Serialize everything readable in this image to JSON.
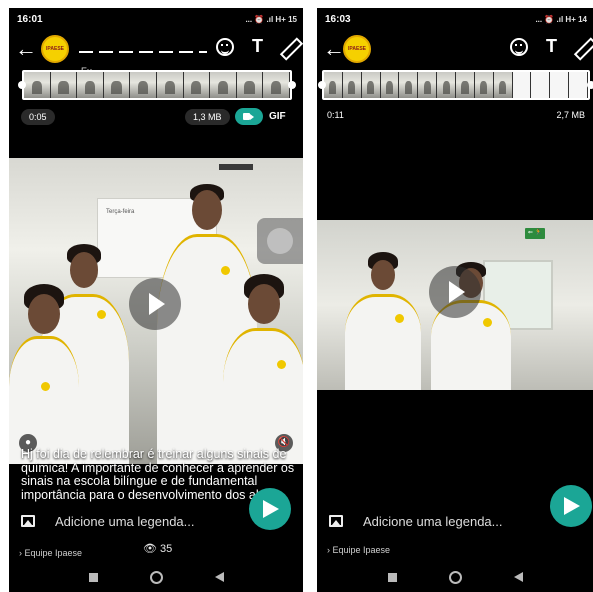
{
  "colors": {
    "accent": "#1ba696",
    "background": "#000000",
    "logo_yellow": "#f5d000"
  },
  "left_screen": {
    "status_time": "16:01",
    "status_icons": "... ⏰ .ıl H+ 15",
    "logo_text": "IPAESE",
    "chat_name": "Eu",
    "duration": "0:05",
    "file_size": "1,3 MB",
    "gif_label": "GIF",
    "caption": "Hj foi dia de relembrar é treinar alguns sinais de química! A importante de conhecer a aprender os sinais na escola bilíngue e de fundamental importância para o desenvolvimento dos al...",
    "caption_placeholder": "Adicione uma legenda...",
    "recipient": "› Equipe Ipaese",
    "views": "35",
    "whiteboard_text": "Terça-feira"
  },
  "right_screen": {
    "status_time": "16:03",
    "status_icons": "... ⏰ .ıl H+ 14",
    "logo_text": "IPAESE",
    "duration": "0:11",
    "file_size": "2,7 MB",
    "exit_sign": "⇐ 🏃",
    "caption_placeholder": "Adicione uma legenda...",
    "recipient": "› Equipe Ipaese"
  },
  "icons": {
    "back": "back-arrow-icon",
    "emoji": "emoji-icon",
    "text": "text-tool-icon",
    "pencil": "pencil-icon",
    "play": "play-icon",
    "send": "send-icon",
    "image": "add-image-icon",
    "eye": "eye-icon"
  },
  "glyphs": {
    "back_arrow": "←",
    "text_tool": "T",
    "eye": "👁",
    "mute": "🔇",
    "person": "●"
  }
}
